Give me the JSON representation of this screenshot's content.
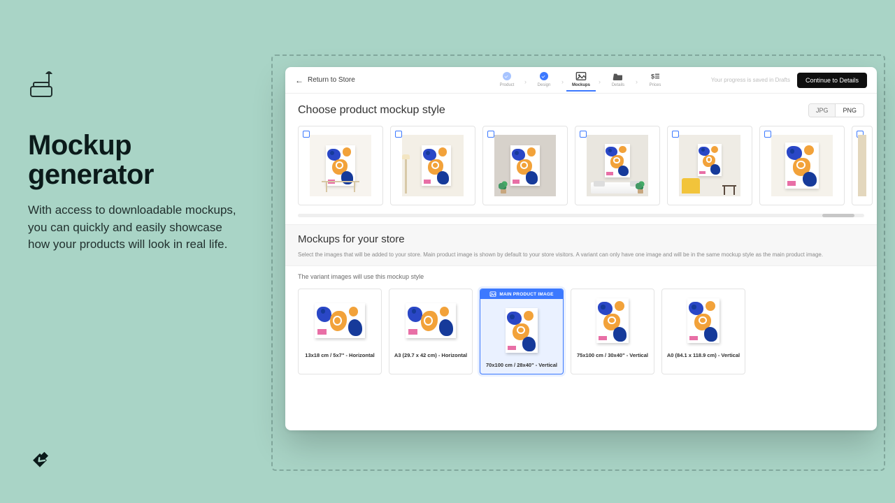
{
  "promo": {
    "title_line1": "Mockup",
    "title_line2": "generator",
    "description": "With access to downloadable mockups, you can quickly and easily showcase how your products will look in real life."
  },
  "topbar": {
    "back_label": "Return to Store",
    "draft_note": "Your progress is saved in Drafts",
    "continue_label": "Continue to Details",
    "steps": {
      "product": "Product",
      "design": "Design",
      "mockups": "Mockups",
      "details": "Details",
      "prices": "Prices"
    }
  },
  "section1": {
    "heading": "Choose product mockup style",
    "format_jpg": "JPG",
    "format_png": "PNG"
  },
  "section2": {
    "heading": "Mockups for your store",
    "help": "Select the images that will be added to your store. Main product image is shown by default to your store visitors. A variant can only have one image and will be in the same mockup style as the main product image.",
    "variant_note": "The variant images will use this mockup style",
    "main_badge": "MAIN PRODUCT IMAGE"
  },
  "store_items": [
    {
      "label": "13x18 cm / 5x7\" - Horizontal",
      "orient": "h",
      "main": false
    },
    {
      "label": "A3 (29.7 x 42 cm) - Horizontal",
      "orient": "h",
      "main": false
    },
    {
      "label": "70x100 cm / 28x40\" - Vertical",
      "orient": "v",
      "main": true
    },
    {
      "label": "75x100 cm / 30x40\" - Vertical",
      "orient": "v",
      "main": false
    },
    {
      "label": "A0 (84.1 x 118.9 cm) - Vertical",
      "orient": "v",
      "main": false
    }
  ]
}
